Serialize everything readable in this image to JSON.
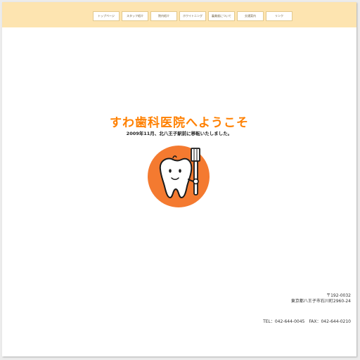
{
  "nav": {
    "items": [
      {
        "label": "トップページ"
      },
      {
        "label": "スタッフ紹介"
      },
      {
        "label": "院内紹介"
      },
      {
        "label": "ホワイトニング"
      },
      {
        "label": "審美歯について"
      },
      {
        "label": "交通案内"
      },
      {
        "label": "リンク"
      }
    ]
  },
  "main": {
    "welcome": "すわ歯科医院へようこそ",
    "notice": "2009年11月、北八王子駅前に移転いたしました。"
  },
  "footer": {
    "postal": "〒192-0032",
    "address": "東京都八王子市石川町2960-24",
    "tel": "TEL：042-644-0045",
    "fax": "FAX：042-644-0210"
  },
  "colors": {
    "accent": "#ff8000",
    "topbar": "#fde4b0",
    "mascot_circle": "#f47a30"
  },
  "icons": {
    "mascot": "tooth-with-toothbrush-icon"
  }
}
